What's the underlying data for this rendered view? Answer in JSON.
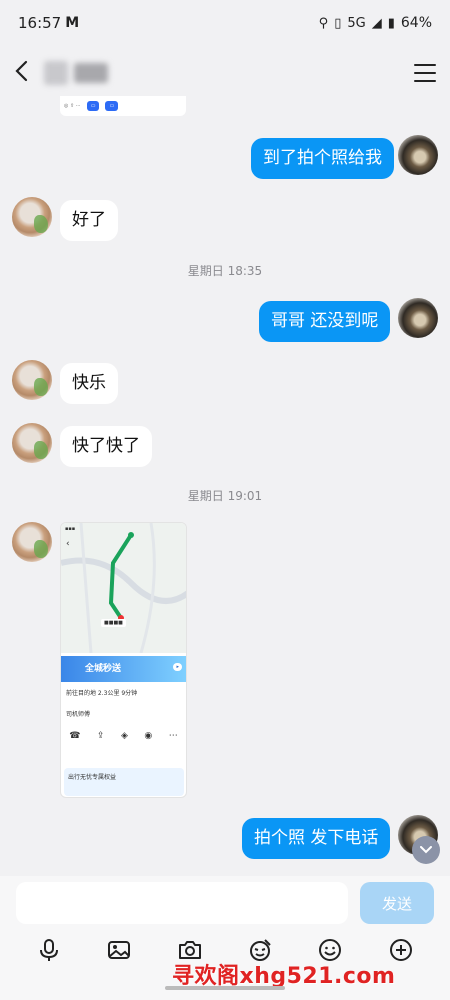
{
  "status_bar": {
    "time": "16:57",
    "mail_indicator": "M",
    "network": "5G",
    "battery": "64%"
  },
  "header": {
    "back_icon": "chevron-left-icon",
    "menu_icon": "hamburger-menu-icon"
  },
  "messages": [
    {
      "from": "me",
      "text": "到了拍个照给我"
    },
    {
      "from": "them",
      "text": "好了"
    },
    {
      "from": "system",
      "text": "星期日 18:35"
    },
    {
      "from": "me",
      "text": "哥哥  还没到呢"
    },
    {
      "from": "them",
      "text": "快乐"
    },
    {
      "from": "them",
      "text": "快了快了"
    },
    {
      "from": "system",
      "text": "星期日 19:01"
    },
    {
      "from": "them",
      "type": "image"
    },
    {
      "from": "me",
      "text": "拍个照  发下电话"
    }
  ],
  "map_image": {
    "banner_text": "全城秒送",
    "line1": "前往目的地 2.3公里 9分钟",
    "line2": "司机师傅",
    "promo": "出行无忧专属权益"
  },
  "input": {
    "placeholder": "",
    "send_label": "发送"
  },
  "toolbar": {
    "items": [
      "microphone-icon",
      "image-icon",
      "camera-icon",
      "sticker-icon",
      "emoji-icon",
      "plus-icon"
    ]
  },
  "watermark": "寻欢阁xhg521.com",
  "colors": {
    "outgoing_bubble": "#0a96f5",
    "incoming_bubble": "#ffffff",
    "background": "#f1f1f3",
    "send_button": "#a9d5f6"
  }
}
